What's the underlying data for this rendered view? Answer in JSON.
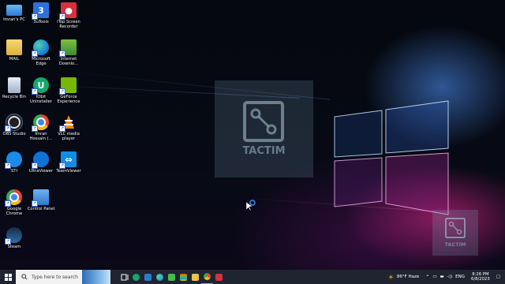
{
  "desktop_icons": [
    {
      "label": "Imran's PC"
    },
    {
      "label": "3uTools"
    },
    {
      "label": "iTop Screen Recorder"
    },
    {
      "label": "MAIL"
    },
    {
      "label": "Microsoft Edge"
    },
    {
      "label": "Internet Downlo..."
    },
    {
      "label": "Recycle Bin"
    },
    {
      "label": "IObit Uninstaller"
    },
    {
      "label": "GeForce Experience"
    },
    {
      "label": "OBS Studio"
    },
    {
      "label": "Imran Hossain (..."
    },
    {
      "label": "VLC media player"
    },
    {
      "label": "STI"
    },
    {
      "label": "UltraViewer"
    },
    {
      "label": "TeamViewer"
    },
    {
      "label": "Google Chrome"
    },
    {
      "label": "Control Panel"
    },
    {
      "label": "Steam"
    }
  ],
  "watermark": {
    "text": "TACTIM"
  },
  "taskbar": {
    "search_placeholder": "Type here to search",
    "weather": "86°F  Haze",
    "language": "ENG",
    "time": "8:26 PM",
    "date": "6/8/2023"
  },
  "colors": {
    "taskbar_bg": "#1e2430",
    "search_bg": "#f2f2f2",
    "accent_blue": "#3a8dff"
  }
}
